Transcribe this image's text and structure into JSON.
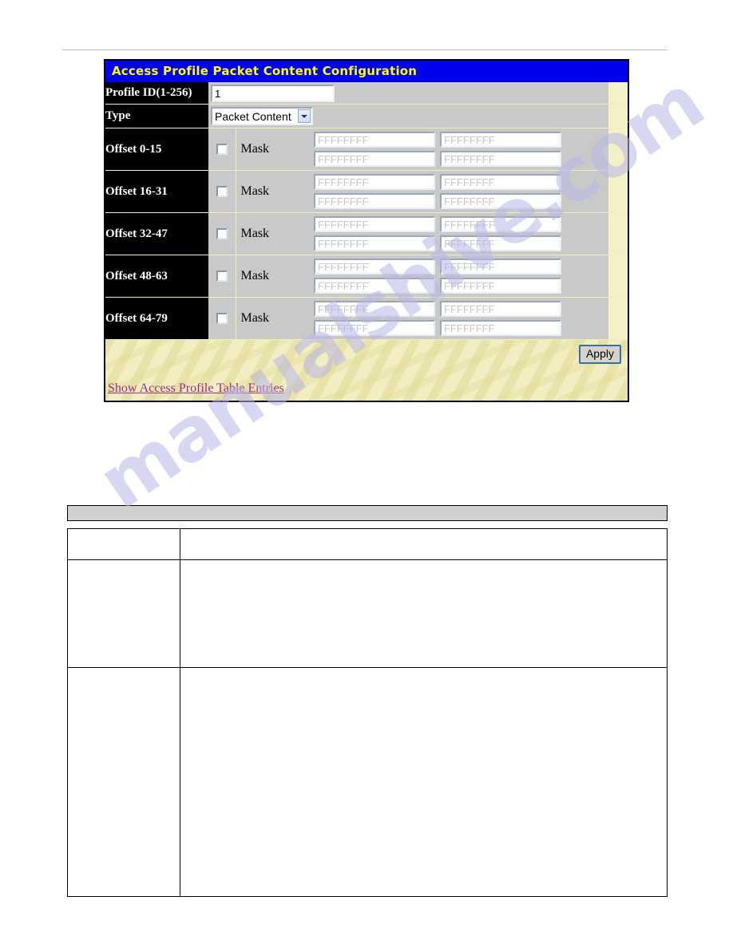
{
  "page": {
    "watermark_text": "manualshive.com"
  },
  "config_panel": {
    "title": "Access Profile Packet Content Configuration",
    "profile_id": {
      "label": "Profile ID(1-256)",
      "value": "1"
    },
    "type": {
      "label": "Type",
      "selected": "Packet Content",
      "options": [
        "Packet Content"
      ]
    },
    "mask_label": "Mask",
    "hex_placeholder": "FFFFFFFF",
    "offset_rows": [
      {
        "label": "Offset 0-15",
        "checked": false,
        "values": [
          "",
          "",
          "",
          ""
        ]
      },
      {
        "label": "Offset 16-31",
        "checked": false,
        "values": [
          "",
          "",
          "",
          ""
        ]
      },
      {
        "label": "Offset 32-47",
        "checked": false,
        "values": [
          "",
          "",
          "",
          ""
        ]
      },
      {
        "label": "Offset 48-63",
        "checked": false,
        "values": [
          "",
          "",
          "",
          ""
        ]
      },
      {
        "label": "Offset 64-79",
        "checked": false,
        "values": [
          "",
          "",
          "",
          ""
        ]
      }
    ],
    "apply_label": "Apply",
    "show_entries_link": "Show Access Profile Table Entries",
    "colors": {
      "title_bar_bg": "#0000EE",
      "title_text": "#FFFF00",
      "label_bg": "#000000",
      "field_bg": "#C9C9C9",
      "footer_bg": "#F2EEC2",
      "link": "#9B2D8E"
    }
  },
  "description_table": {
    "header": "",
    "column_headers": [
      "",
      ""
    ],
    "rows": [
      {
        "parameter": "",
        "description": ""
      },
      {
        "parameter": "",
        "description": ""
      },
      {
        "parameter": "",
        "description": ""
      }
    ]
  }
}
